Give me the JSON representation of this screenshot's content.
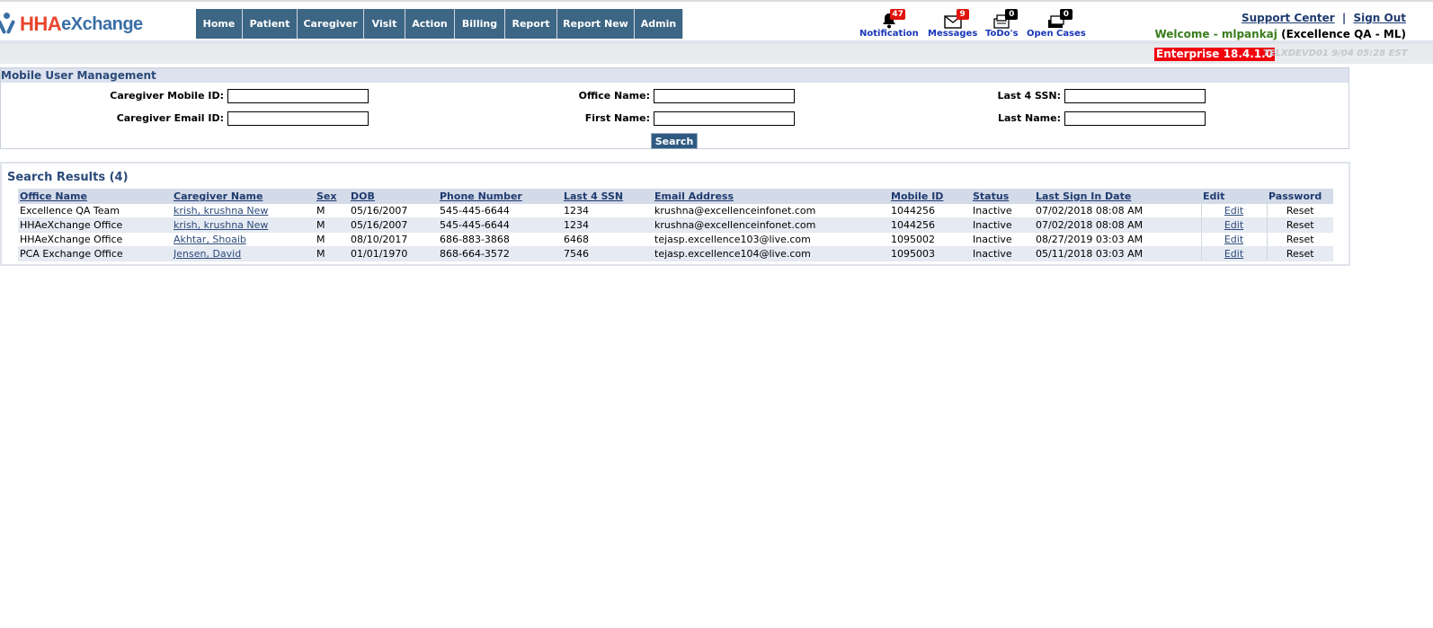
{
  "header": {
    "logo_hha": "HHA",
    "logo_exchange": "eXchange",
    "nav": [
      "Home",
      "Patient",
      "Caregiver",
      "Visit",
      "Action",
      "Billing",
      "Report",
      "Report New",
      "Admin"
    ],
    "notifications": [
      {
        "label": "Notification",
        "count": "47",
        "icon": "bell-icon",
        "badge_color": "#e0140c"
      },
      {
        "label": "Messages",
        "count": "9",
        "icon": "envelope-icon",
        "badge_color": "#e0140c"
      },
      {
        "label": "ToDo's",
        "count": "0",
        "icon": "todo-icon",
        "badge_color": "#000000"
      },
      {
        "label": "Open Cases",
        "count": "0",
        "icon": "cases-icon",
        "badge_color": "#000000"
      }
    ],
    "support_center": "Support Center",
    "separator": "|",
    "sign_out": "Sign Out",
    "welcome_prefix": "Welcome - mlpankaj",
    "welcome_org": "(Excellence QA - ML)",
    "version": "Enterprise 18.4.1.0",
    "server_info": "TELXDEVD01 9/04 05:28 EST"
  },
  "search": {
    "title": "Mobile User Management",
    "fields": {
      "caregiver_mobile_id": {
        "label": "Caregiver Mobile ID:",
        "value": ""
      },
      "caregiver_email_id": {
        "label": "Caregiver Email ID:",
        "value": ""
      },
      "office_name": {
        "label": "Office Name:",
        "value": ""
      },
      "first_name": {
        "label": "First Name:",
        "value": ""
      },
      "last4_ssn": {
        "label": "Last 4 SSN:",
        "value": ""
      },
      "last_name": {
        "label": "Last Name:",
        "value": ""
      }
    },
    "button": "Search"
  },
  "results": {
    "title": "Search Results  (4)",
    "columns": [
      "Office Name",
      "Caregiver Name",
      "Sex",
      "DOB",
      "Phone Number",
      "Last 4 SSN",
      "Email Address",
      "Mobile ID",
      "Status",
      "Last Sign In Date",
      "Edit",
      "Password"
    ],
    "rows": [
      [
        "Excellence QA Team",
        "krish, krushna New",
        "M",
        "05/16/2007",
        "545-445-6644",
        "1234",
        "krushna@excellenceinfonet.com",
        "1044256",
        "Inactive",
        "07/02/2018 08:08 AM",
        "Edit",
        "Reset"
      ],
      [
        "HHAeXchange Office",
        "krish, krushna New",
        "M",
        "05/16/2007",
        "545-445-6644",
        "1234",
        "krushna@excellenceinfonet.com",
        "1044256",
        "Inactive",
        "07/02/2018 08:08 AM",
        "Edit",
        "Reset"
      ],
      [
        "HHAeXchange Office",
        "Akhtar, Shoaib",
        "M",
        "08/10/2017",
        "686-883-3868",
        "6468",
        "tejasp.excellence103@live.com",
        "1095002",
        "Inactive",
        "08/27/2019 03:03 AM",
        "Edit",
        "Reset"
      ],
      [
        "PCA Exchange Office",
        "Jensen, David",
        "M",
        "01/01/1970",
        "868-664-3572",
        "7546",
        "tejasp.excellence104@live.com",
        "1095003",
        "Inactive",
        "05/11/2018 03:03 AM",
        "Edit",
        "Reset"
      ]
    ]
  }
}
